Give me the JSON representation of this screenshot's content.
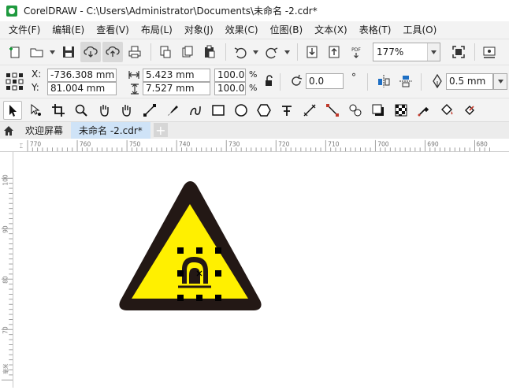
{
  "window": {
    "title": "CorelDRAW - C:\\Users\\Administrator\\Documents\\未命名 -2.cdr*"
  },
  "menu": [
    "文件(F)",
    "编辑(E)",
    "查看(V)",
    "布局(L)",
    "对象(J)",
    "效果(C)",
    "位图(B)",
    "文本(X)",
    "表格(T)",
    "工具(O)"
  ],
  "toolbar": {
    "zoom": "177%",
    "pdf_label": "PDF"
  },
  "properties": {
    "x_label": "X:",
    "x_value": "-736.308 mm",
    "y_label": "Y:",
    "y_value": "81.004 mm",
    "width_value": "5.423 mm",
    "height_value": "7.527 mm",
    "scale_w": "100.0",
    "scale_h": "100.0",
    "pct_w": "%",
    "pct_h": "%",
    "rotation": "0.0",
    "degree": "°",
    "outline_width": "0.5 mm"
  },
  "tabs": {
    "welcome": "欢迎屏幕",
    "document": "未命名 -2.cdr*",
    "add": "+"
  },
  "ruler": {
    "h_ticks": [
      "770",
      "760",
      "750",
      "740",
      "730",
      "720",
      "710",
      "700",
      "690",
      "680"
    ],
    "v_ticks": [
      "100",
      "90",
      "80",
      "70"
    ],
    "unit": "毫米"
  },
  "colors": {
    "sign_fill": "#FFF000",
    "sign_border": "#231815",
    "selection_handle": "#000000",
    "active_tab": "#CFE3F7",
    "app_icon": "#1F9A3F"
  },
  "icons": {
    "toolbar": [
      "new-document-icon",
      "open-folder-icon",
      "save-icon",
      "cloud-download-icon",
      "cloud-upload-icon",
      "print-icon",
      "cut-icon",
      "copy-icon",
      "paste-icon",
      "undo-icon",
      "redo-icon",
      "import-icon",
      "export-icon",
      "publish-pdf-icon",
      "full-screen-icon",
      "options-icon"
    ],
    "toolbox": [
      "pick-tool-icon",
      "shape-tool-icon",
      "crop-tool-icon",
      "zoom-tool-icon",
      "pan-tool-icon",
      "freehand-tool-icon",
      "artistic-media-tool-icon",
      "smart-drawing-tool-icon",
      "rectangle-tool-icon",
      "ellipse-tool-icon",
      "polygon-tool-icon",
      "text-tool-icon",
      "parallel-dimension-tool-icon",
      "connector-tool-icon",
      "blend-tool-icon",
      "drop-shadow-tool-icon",
      "transparency-tool-icon",
      "eyedropper-tool-icon",
      "interactive-fill-tool-icon"
    ]
  }
}
